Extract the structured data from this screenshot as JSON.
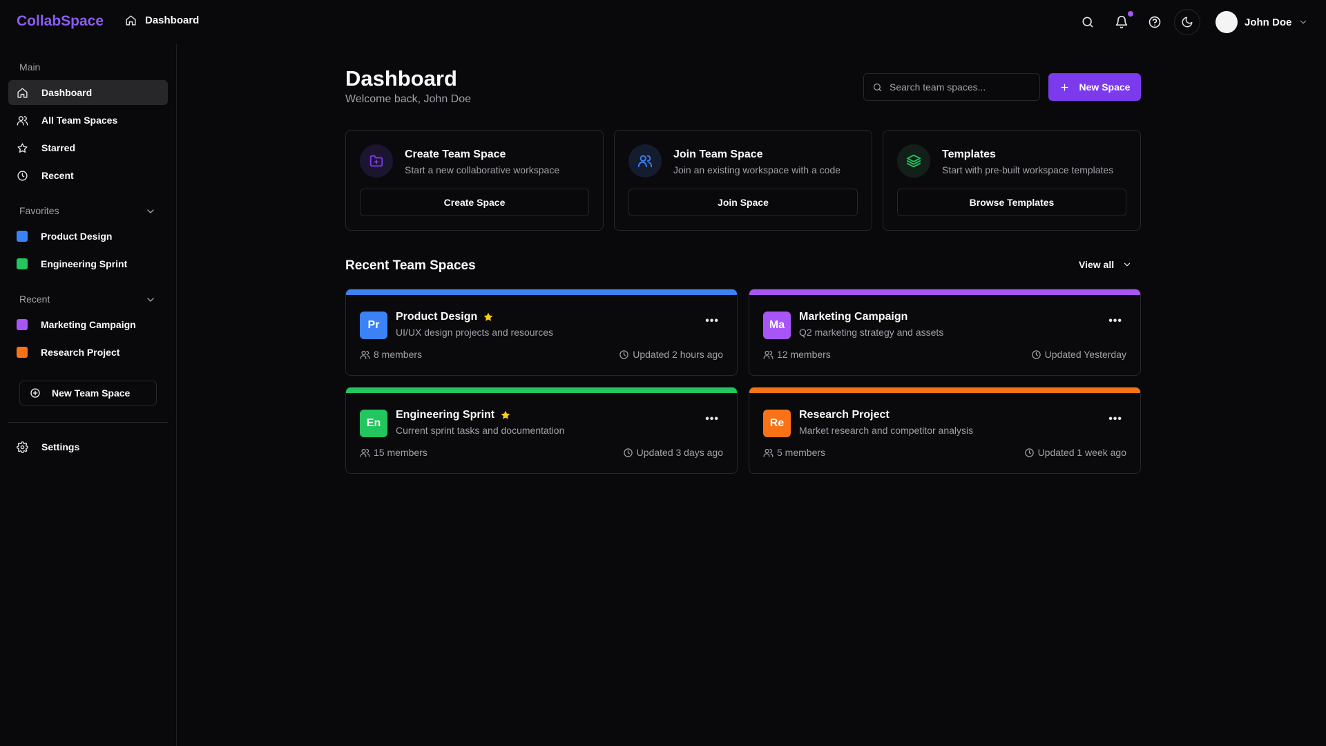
{
  "app": {
    "name": "CollabSpace"
  },
  "header": {
    "breadcrumb": "Dashboard",
    "user_name": "John Doe",
    "accent_color": "#8b5cf6",
    "notification_dot_color": "#a855f7"
  },
  "sidebar": {
    "main_label": "Main",
    "main_items": [
      {
        "label": "Dashboard",
        "icon": "home-icon",
        "active": true
      },
      {
        "label": "All Team Spaces",
        "icon": "users-icon"
      },
      {
        "label": "Starred",
        "icon": "star-icon"
      },
      {
        "label": "Recent",
        "icon": "clock-icon"
      }
    ],
    "favorites_label": "Favorites",
    "favorites": [
      {
        "label": "Product Design",
        "color": "#3b82f6"
      },
      {
        "label": "Engineering Sprint",
        "color": "#22c55e"
      }
    ],
    "recent_label": "Recent",
    "recent": [
      {
        "label": "Marketing Campaign",
        "color": "#a855f7"
      },
      {
        "label": "Research Project",
        "color": "#f97316"
      }
    ],
    "new_team_space": "New Team Space",
    "settings": "Settings"
  },
  "main": {
    "title": "Dashboard",
    "subtitle": "Welcome back, John Doe",
    "search_placeholder": "Search team spaces...",
    "new_space_label": "New Space",
    "quick_actions": [
      {
        "title": "Create Team Space",
        "description": "Start a new collaborative workspace",
        "button": "Create Space",
        "icon": "folder-plus-icon",
        "color": "#7c3aed"
      },
      {
        "title": "Join Team Space",
        "description": "Join an existing workspace with a code",
        "button": "Join Space",
        "icon": "users-icon",
        "color": "#3b82f6"
      },
      {
        "title": "Templates",
        "description": "Start with pre-built workspace templates",
        "button": "Browse Templates",
        "icon": "layers-icon",
        "color": "#22c55e"
      }
    ],
    "recent_title": "Recent Team Spaces",
    "view_all": "View all",
    "spaces": [
      {
        "initials": "Pr",
        "name": "Product Design",
        "starred": true,
        "description": "UI/UX design projects and resources",
        "members": "8 members",
        "updated": "Updated 2 hours ago",
        "color": "#3b82f6"
      },
      {
        "initials": "Ma",
        "name": "Marketing Campaign",
        "starred": false,
        "description": "Q2 marketing strategy and assets",
        "members": "12 members",
        "updated": "Updated Yesterday",
        "color": "#a855f7"
      },
      {
        "initials": "En",
        "name": "Engineering Sprint",
        "starred": true,
        "description": "Current sprint tasks and documentation",
        "members": "15 members",
        "updated": "Updated 3 days ago",
        "color": "#22c55e"
      },
      {
        "initials": "Re",
        "name": "Research Project",
        "starred": false,
        "description": "Market research and competitor analysis",
        "members": "5 members",
        "updated": "Updated 1 week ago",
        "color": "#f97316"
      }
    ],
    "star_color": "#facc15"
  }
}
